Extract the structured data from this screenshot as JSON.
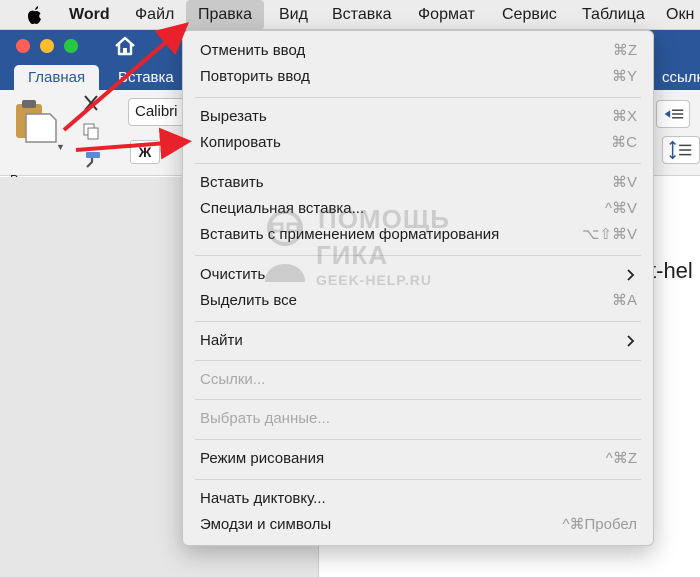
{
  "menubar": {
    "app": "Word",
    "items": [
      "Файл",
      "Правка",
      "Вид",
      "Вставка",
      "Формат",
      "Сервис",
      "Таблица",
      "Окн"
    ],
    "active": "Правка"
  },
  "ribbon": {
    "tabs": {
      "home": "Главная",
      "insert": "Вставка",
      "right": "ссылки"
    },
    "paste_label": "Вставить",
    "font_name": "Calibri",
    "bold": "Ж"
  },
  "document": {
    "visible_text": "t-hel"
  },
  "edit_menu": {
    "items": [
      {
        "label": "Отменить ввод",
        "shortcut": "⌘Z"
      },
      {
        "label": "Повторить ввод",
        "shortcut": "⌘Y"
      },
      {
        "label": "Вырезать",
        "shortcut": "⌘X"
      },
      {
        "label": "Копировать",
        "shortcut": "⌘C"
      },
      {
        "label": "Вставить",
        "shortcut": "⌘V"
      },
      {
        "label": "Специальная вставка...",
        "shortcut": "^⌘V"
      },
      {
        "label": "Вставить с применением форматирования",
        "shortcut": "⌥⇧⌘V"
      },
      {
        "label": "Очистить",
        "shortcut": ""
      },
      {
        "label": "Выделить все",
        "shortcut": "⌘A"
      },
      {
        "label": "Найти",
        "shortcut": ""
      },
      {
        "label": "Ссылки...",
        "shortcut": ""
      },
      {
        "label": "Выбрать данные...",
        "shortcut": ""
      },
      {
        "label": "Режим рисования",
        "shortcut": "^⌘Z"
      },
      {
        "label": "Начать диктовку...",
        "shortcut": ""
      },
      {
        "label": "Эмодзи и символы",
        "shortcut": "^⌘Пробел"
      }
    ]
  },
  "watermark": {
    "line1": "ПОМОЩЬ",
    "line2": "ГИКА",
    "line3": "GEEK-HELP.RU"
  },
  "colors": {
    "word_blue": "#2b579a",
    "arrow_red": "#e8222b",
    "menu_bg": "#efefef"
  }
}
